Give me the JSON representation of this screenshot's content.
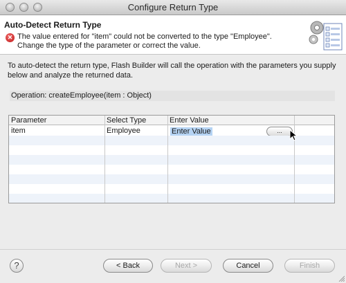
{
  "window": {
    "title": "Configure Return Type"
  },
  "header": {
    "title": "Auto-Detect Return Type",
    "error_message": "The value entered for \"item\" could not be converted to the type \"Employee\". Change the type of the parameter or correct the value."
  },
  "description": "To auto-detect the return type, Flash Builder will call the operation with the parameters you supply below and analyze the returned data.",
  "operation": {
    "text": "Operation:  createEmployee(item : Object)"
  },
  "table": {
    "columns": [
      "Parameter",
      "Select Type",
      "Enter Value"
    ],
    "rows": [
      {
        "parameter": "item",
        "type": "Employee",
        "value": "Enter Value",
        "browse_label": "..."
      }
    ]
  },
  "footer": {
    "help_label": "?",
    "back_label": "< Back",
    "next_label": "Next >",
    "cancel_label": "Cancel",
    "finish_label": "Finish"
  },
  "colors": {
    "selection": "#b5d3f3",
    "error": "#c01818",
    "stripe": "#eef3fa"
  }
}
